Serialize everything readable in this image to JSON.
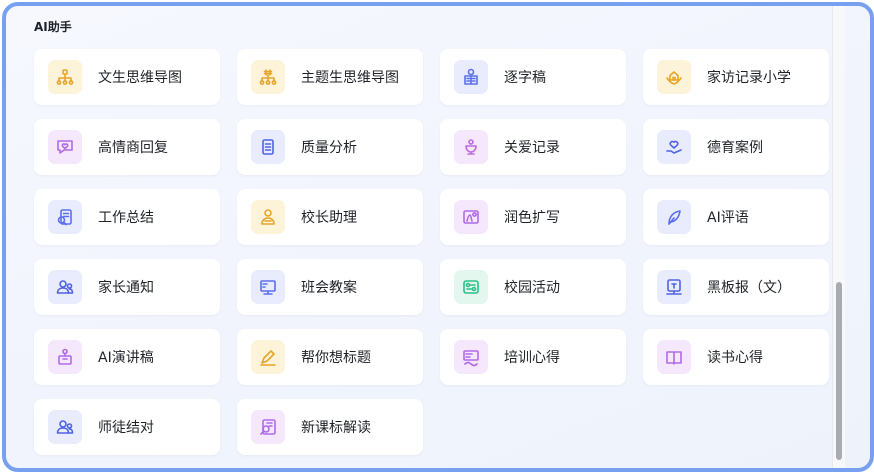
{
  "section": {
    "title": "AI助手"
  },
  "items": [
    {
      "label": "文生思维导图",
      "icon": "mindmap-icon",
      "bg": "#fdf3d9",
      "fg": "#e6a52a"
    },
    {
      "label": "主题生思维导图",
      "icon": "topic-mindmap-icon",
      "bg": "#fdf3d9",
      "fg": "#e6a52a"
    },
    {
      "label": "逐字稿",
      "icon": "transcript-icon",
      "bg": "#e8ecfd",
      "fg": "#5b6ff0"
    },
    {
      "label": "家访记录小学",
      "icon": "home-visit-icon",
      "bg": "#fdf3d9",
      "fg": "#e6a52a"
    },
    {
      "label": "高情商回复",
      "icon": "chat-heart-icon",
      "bg": "#f5e8fd",
      "fg": "#b06ae8"
    },
    {
      "label": "质量分析",
      "icon": "report-icon",
      "bg": "#e8ecfd",
      "fg": "#4f63e6"
    },
    {
      "label": "关爱记录",
      "icon": "care-icon",
      "bg": "#f5e8fd",
      "fg": "#c06ae0"
    },
    {
      "label": "德育案例",
      "icon": "heart-hand-icon",
      "bg": "#e8ecfd",
      "fg": "#4f63e6"
    },
    {
      "label": "工作总结",
      "icon": "summary-icon",
      "bg": "#e8ecfd",
      "fg": "#5b6ff0"
    },
    {
      "label": "校长助理",
      "icon": "principal-icon",
      "bg": "#fdf3d9",
      "fg": "#e6a52a"
    },
    {
      "label": "润色扩写",
      "icon": "polish-icon",
      "bg": "#f5e8fd",
      "fg": "#b06ae8"
    },
    {
      "label": "AI评语",
      "icon": "quill-icon",
      "bg": "#e8ecfd",
      "fg": "#5b6ff0"
    },
    {
      "label": "家长通知",
      "icon": "parents-icon",
      "bg": "#e8ecfd",
      "fg": "#4f63e6"
    },
    {
      "label": "班会教案",
      "icon": "class-plan-icon",
      "bg": "#e8ecfd",
      "fg": "#5b6ff0"
    },
    {
      "label": "校园活动",
      "icon": "activity-icon",
      "bg": "#e3f7ee",
      "fg": "#2fbf8a"
    },
    {
      "label": "黑板报（文）",
      "icon": "blackboard-icon",
      "bg": "#e8ecfd",
      "fg": "#4f63e6"
    },
    {
      "label": "AI演讲稿",
      "icon": "speech-icon",
      "bg": "#f5e8fd",
      "fg": "#b06ae8"
    },
    {
      "label": "帮你想标题",
      "icon": "pen-write-icon",
      "bg": "#fdf3d9",
      "fg": "#e6a52a"
    },
    {
      "label": "培训心得",
      "icon": "training-icon",
      "bg": "#f5e8fd",
      "fg": "#b06ae8"
    },
    {
      "label": "读书心得",
      "icon": "book-icon",
      "bg": "#f5e8fd",
      "fg": "#b06ae8"
    },
    {
      "label": "师徒结对",
      "icon": "mentor-icon",
      "bg": "#e8ecfd",
      "fg": "#4f63e6"
    },
    {
      "label": "新课标解读",
      "icon": "curriculum-icon",
      "bg": "#f5e8fd",
      "fg": "#b06ae8"
    }
  ]
}
